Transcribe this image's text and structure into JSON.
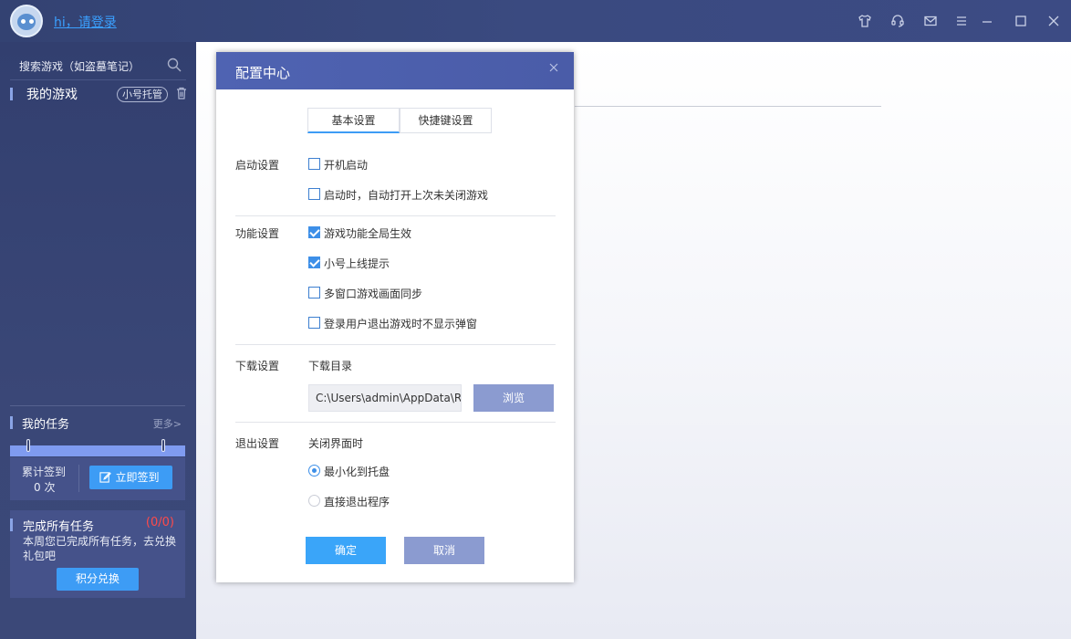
{
  "titlebar": {
    "login_text": "hi，请登录",
    "icons": [
      "tshirt-icon",
      "headset-icon",
      "mail-icon",
      "menu-icon",
      "minimize-icon",
      "maximize-icon",
      "close-icon"
    ]
  },
  "sidebar": {
    "search_placeholder": "搜索游戏（如盗墓笔记）",
    "my_games_label": "我的游戏",
    "alt_account_pill": "小号托管",
    "tasks_label": "我的任务",
    "tasks_more": "更多>",
    "checkin_label": "累计签到",
    "checkin_count": "0 次",
    "checkin_button": "立即签到",
    "all_tasks_title": "完成所有任务",
    "all_tasks_count": "(0/0)",
    "all_tasks_desc": "本周您已完成所有任务，去兑换礼包吧",
    "points_button": "积分兑换"
  },
  "dialog": {
    "title": "配置中心",
    "tabs": [
      {
        "label": "基本设置",
        "active": true
      },
      {
        "label": "快捷键设置",
        "active": false
      }
    ],
    "startup": {
      "label": "启动设置",
      "options": [
        {
          "label": "开机启动",
          "checked": false
        },
        {
          "label": "启动时，自动打开上次未关闭游戏",
          "checked": false
        }
      ]
    },
    "features": {
      "label": "功能设置",
      "options": [
        {
          "label": "游戏功能全局生效",
          "checked": true
        },
        {
          "label": "小号上线提示",
          "checked": true
        },
        {
          "label": "多窗口游戏画面同步",
          "checked": false
        },
        {
          "label": "登录用户退出游戏时不显示弹窗",
          "checked": false
        }
      ]
    },
    "download": {
      "label": "下载设置",
      "dir_label": "下载目录",
      "path_value": "C:\\Users\\admin\\AppData\\R",
      "browse_button": "浏览"
    },
    "exit": {
      "label": "退出设置",
      "close_label": "关闭界面时",
      "options": [
        {
          "label": "最小化到托盘",
          "selected": true
        },
        {
          "label": "直接退出程序",
          "selected": false
        }
      ]
    },
    "ok_button": "确定",
    "cancel_button": "取消"
  },
  "colors": {
    "accent": "#3d9cf5",
    "sidebar_bg": "#3a4777",
    "dialog_header": "#4f63b2",
    "secondary_button": "#8b9bd0",
    "danger": "#ff4a4a"
  }
}
